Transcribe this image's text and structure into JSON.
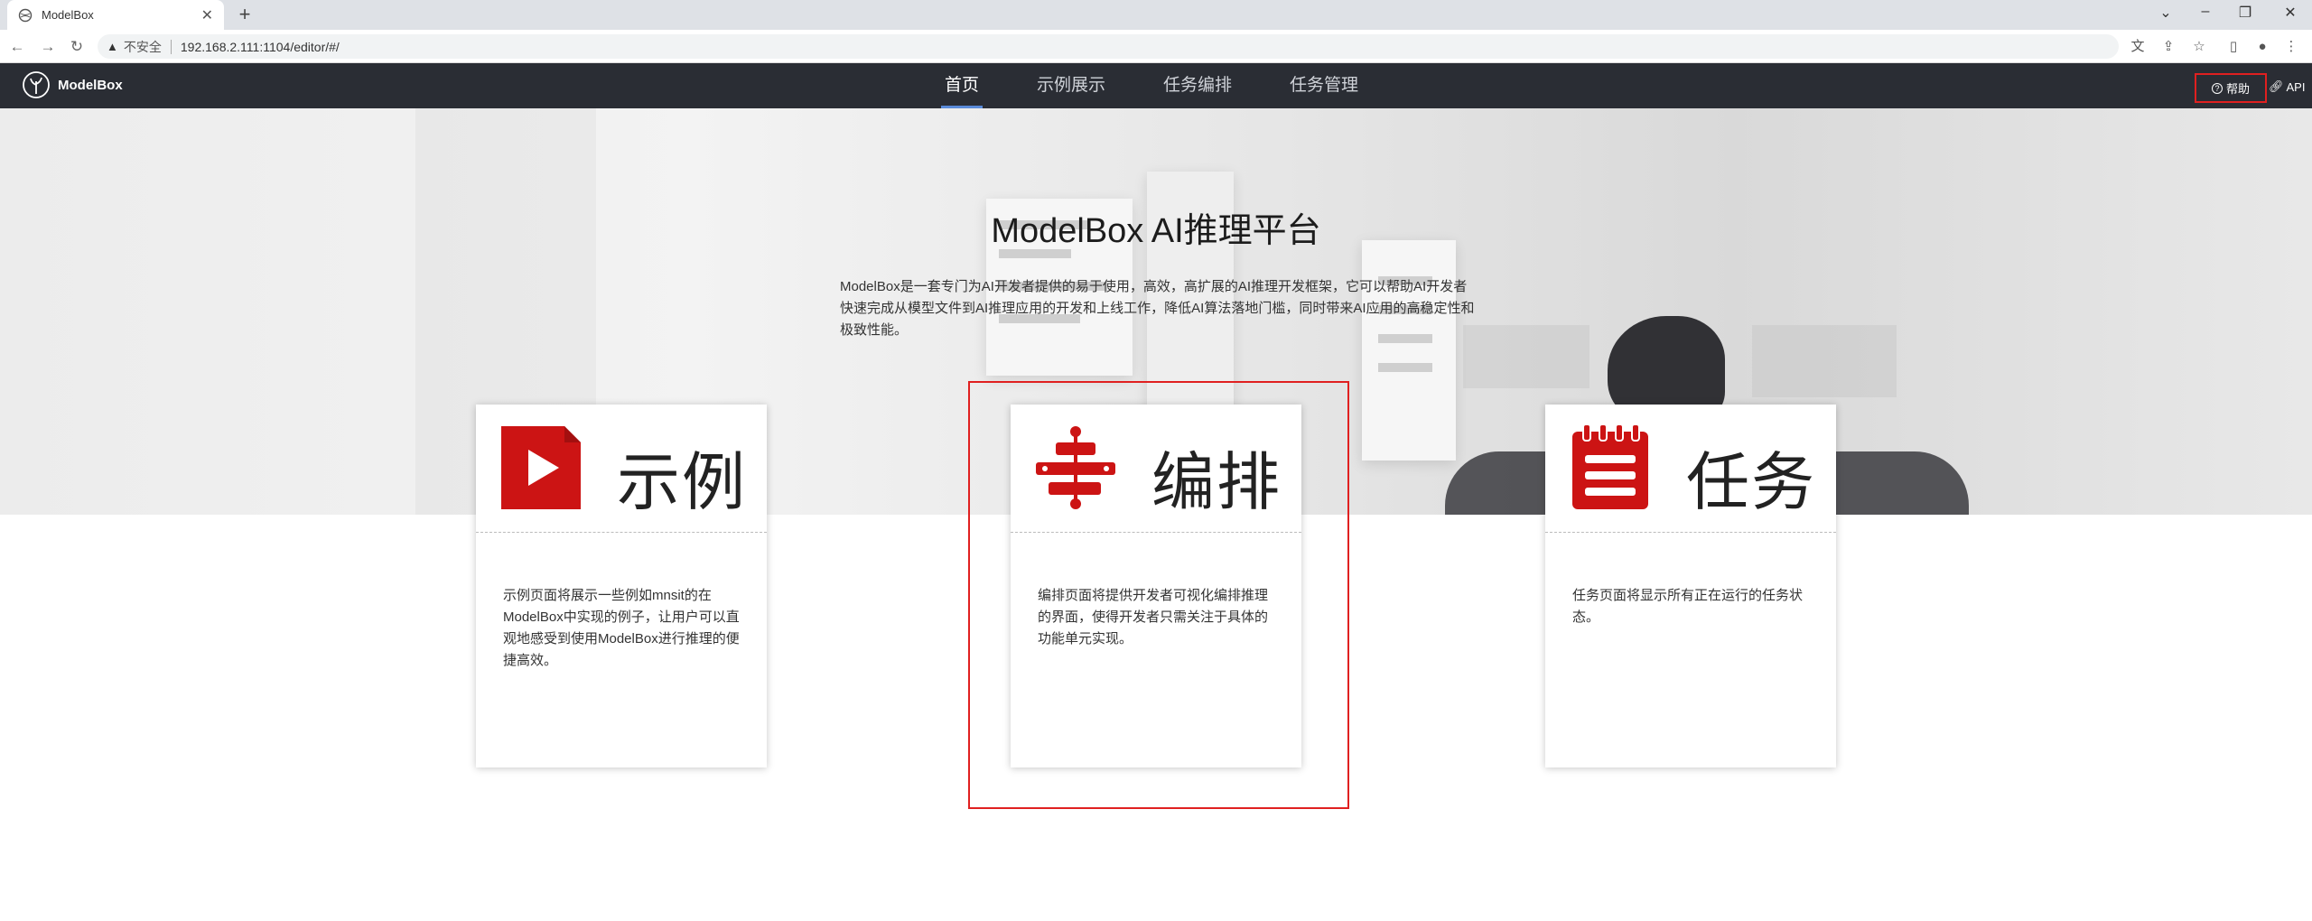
{
  "browser": {
    "tab_title": "ModelBox",
    "security_label": "不安全",
    "url": "192.168.2.111:1104/editor/#/"
  },
  "header": {
    "logo_text": "ModelBox",
    "nav": [
      {
        "label": "首页",
        "active": true
      },
      {
        "label": "示例展示",
        "active": false
      },
      {
        "label": "任务编排",
        "active": false
      },
      {
        "label": "任务管理",
        "active": false
      }
    ],
    "help_label": "帮助",
    "api_label": "API"
  },
  "hero": {
    "title": "ModelBox AI推理平台",
    "description": "ModelBox是一套专门为AI开发者提供的易于使用，高效，高扩展的AI推理开发框架，它可以帮助AI开发者快速完成从模型文件到AI推理应用的开发和上线工作，降低AI算法落地门槛，同时带来AI应用的高稳定性和极致性能。"
  },
  "cards": [
    {
      "title": "示例",
      "icon": "play-icon",
      "description": "示例页面将展示一些例如mnsit的在ModelBox中实现的例子，让用户可以直观地感受到使用ModelBox进行推理的便捷高效。"
    },
    {
      "title": "编排",
      "icon": "flow-icon",
      "description": "编排页面将提供开发者可视化编排推理的界面，使得开发者只需关注于具体的功能单元实现。"
    },
    {
      "title": "任务",
      "icon": "notepad-icon",
      "description": "任务页面将显示所有正在运行的任务状态。"
    }
  ],
  "colors": {
    "accent_red": "#cc1414",
    "header_bg": "#2a2d34",
    "active_underline": "#5a8bd9",
    "highlight_border": "#e02020"
  }
}
